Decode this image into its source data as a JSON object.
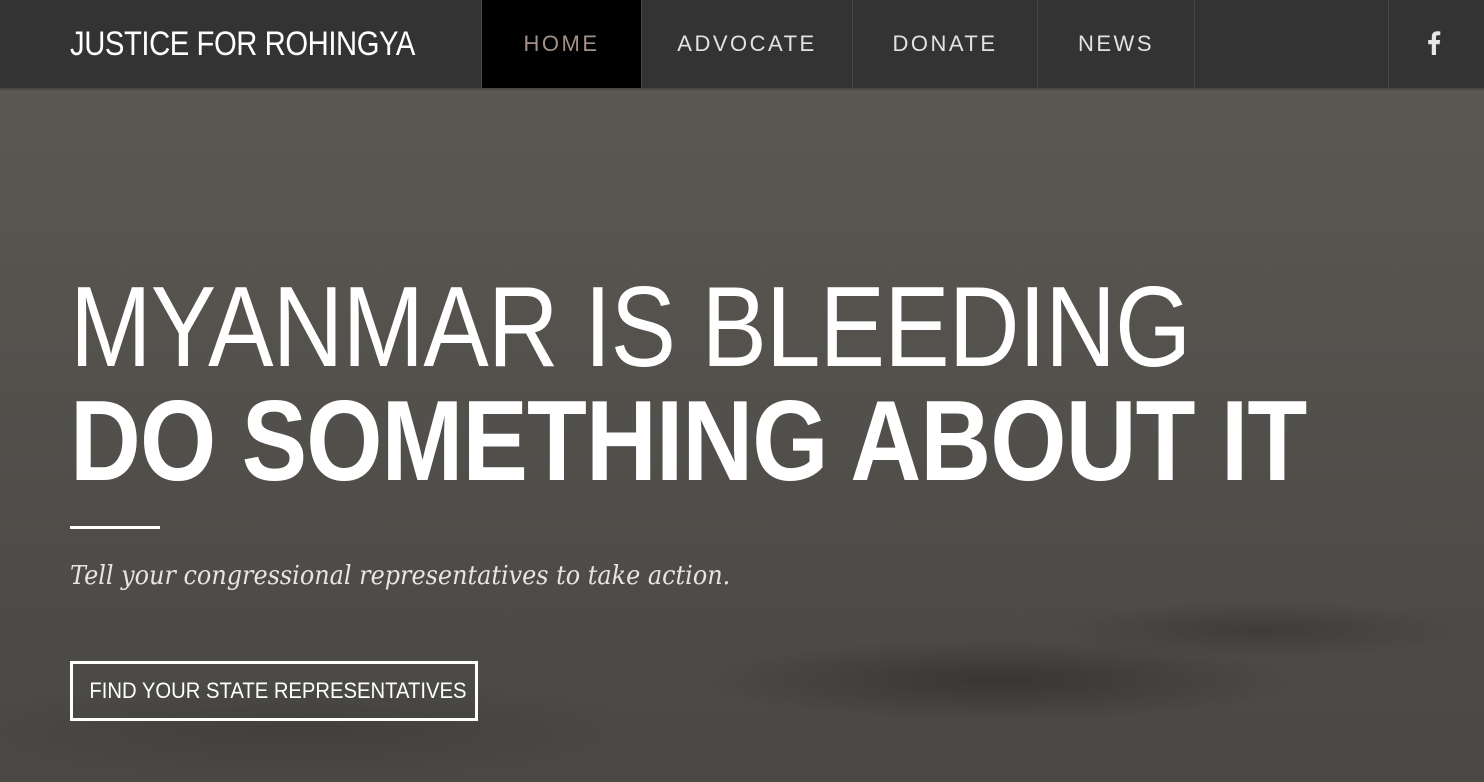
{
  "brand": {
    "title": "JUSTICE FOR ROHINGYA"
  },
  "nav": {
    "items": [
      {
        "label": "HOME",
        "active": true
      },
      {
        "label": "ADVOCATE",
        "active": false
      },
      {
        "label": "DONATE",
        "active": false
      },
      {
        "label": "NEWS",
        "active": false
      }
    ],
    "social_icon": "facebook-icon"
  },
  "hero": {
    "headline_line1": "MYANMAR IS BLEEDING",
    "headline_line2": "DO SOMETHING ABOUT IT",
    "tagline": "Tell your congressional representatives to take action.",
    "cta_label": "FIND YOUR STATE REPRESENTATIVES"
  },
  "colors": {
    "nav_background": "#333333",
    "nav_active_background": "#000000",
    "nav_active_text": "#a48f86",
    "hero_overlay": "#55524e",
    "text": "#ffffff"
  }
}
